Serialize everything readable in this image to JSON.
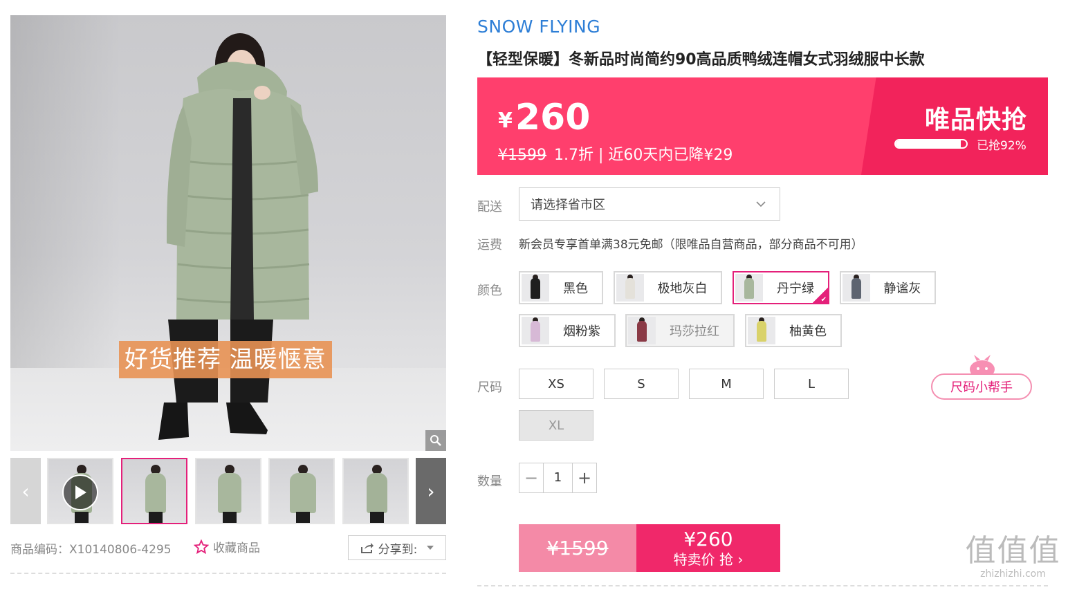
{
  "gallery": {
    "promo_text": "好货推荐 温暖惬意",
    "zoom_icon": "magnifier-icon",
    "prev_arrow": "‹",
    "next_arrow": "›",
    "thumbnails": [
      {
        "type": "video"
      },
      {
        "type": "image",
        "active": true
      },
      {
        "type": "image"
      },
      {
        "type": "image"
      },
      {
        "type": "image"
      },
      {
        "type": "image"
      }
    ],
    "product_code": "商品编码：X10140806-4295",
    "favorite_label": "收藏商品",
    "share_label": "分享到:"
  },
  "product": {
    "brand": "SNOW FLYING",
    "title": "【轻型保暖】冬新品时尚简约90高品质鸭绒连帽女式羽绒服中长款"
  },
  "price": {
    "currency": "¥",
    "current": "260",
    "original": "¥1599",
    "discount_info": "1.7折 | 近60天内已降¥29",
    "flash_title": "唯品快抢",
    "sold_percent": 92,
    "sold_text": "已抢92%"
  },
  "delivery": {
    "label": "配送",
    "placeholder": "请选择省市区"
  },
  "shipping": {
    "label": "运费",
    "text": "新会员专享首单满38元免邮（限唯品自营商品，部分商品不可用）"
  },
  "colors": {
    "label": "颜色",
    "options": [
      {
        "name": "黑色",
        "swatch": "#1e1e1e",
        "selected": false,
        "disabled": false
      },
      {
        "name": "极地灰白",
        "swatch": "#e4e1da",
        "selected": false,
        "disabled": false
      },
      {
        "name": "丹宁绿",
        "swatch": "#a8b79d",
        "selected": true,
        "disabled": false
      },
      {
        "name": "静谧灰",
        "swatch": "#5d6470",
        "selected": false,
        "disabled": false
      },
      {
        "name": "烟粉紫",
        "swatch": "#d7b9d6",
        "selected": false,
        "disabled": false
      },
      {
        "name": "玛莎拉红",
        "swatch": "#8a3a46",
        "selected": false,
        "disabled": true
      },
      {
        "name": "柚黄色",
        "swatch": "#d9d26a",
        "selected": false,
        "disabled": false
      }
    ]
  },
  "sizes": {
    "label": "尺码",
    "options": [
      {
        "name": "XS",
        "disabled": false
      },
      {
        "name": "S",
        "disabled": false
      },
      {
        "name": "M",
        "disabled": false
      },
      {
        "name": "L",
        "disabled": false
      },
      {
        "name": "XL",
        "disabled": true
      }
    ],
    "helper_label": "尺码小帮手"
  },
  "quantity": {
    "label": "数量",
    "value": "1",
    "minus": "−",
    "plus": "+"
  },
  "buy": {
    "original": "¥1599",
    "price": "¥260",
    "action": "特卖价 抢 ›"
  },
  "watermark": {
    "big": "值值值",
    "small": "zhizhizhi.com"
  },
  "colors_theme": {
    "accent": "#ff3f6d",
    "accent_dark": "#f2235b",
    "select_border": "#e4207a",
    "brand_blue": "#2d7ed6"
  }
}
